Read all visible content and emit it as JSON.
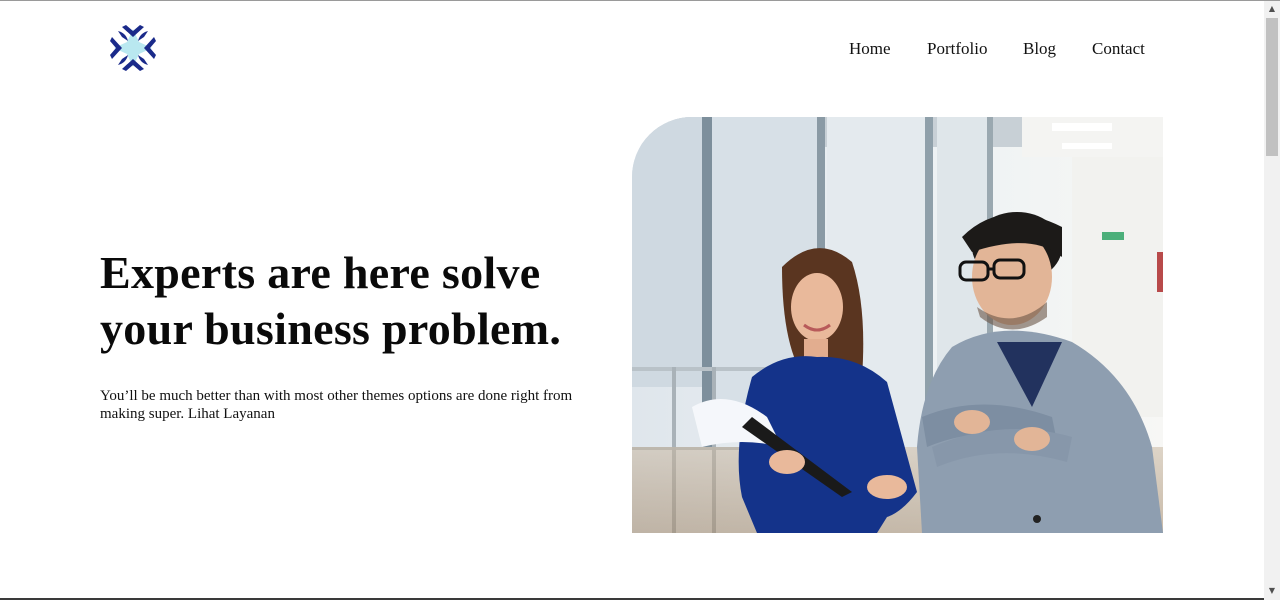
{
  "nav": {
    "items": [
      {
        "label": "Home"
      },
      {
        "label": "Portfolio"
      },
      {
        "label": "Blog"
      },
      {
        "label": "Contact"
      }
    ]
  },
  "hero": {
    "title_line1": "Experts are here solve",
    "title_line2": "your business problem.",
    "description": "You’ll be much better than with most other themes options are done right from making super. Lihat Layanan"
  },
  "icons": {
    "logo": "four-point-star-logo",
    "scroll_up": "triangle-up-icon",
    "scroll_down": "triangle-down-icon"
  },
  "colors": {
    "logo_dark": "#1a2a8a",
    "logo_light": "#b9e8f0",
    "text": "#111111",
    "background": "#ffffff"
  },
  "image": {
    "subject": "photo-two-colleagues-office"
  }
}
